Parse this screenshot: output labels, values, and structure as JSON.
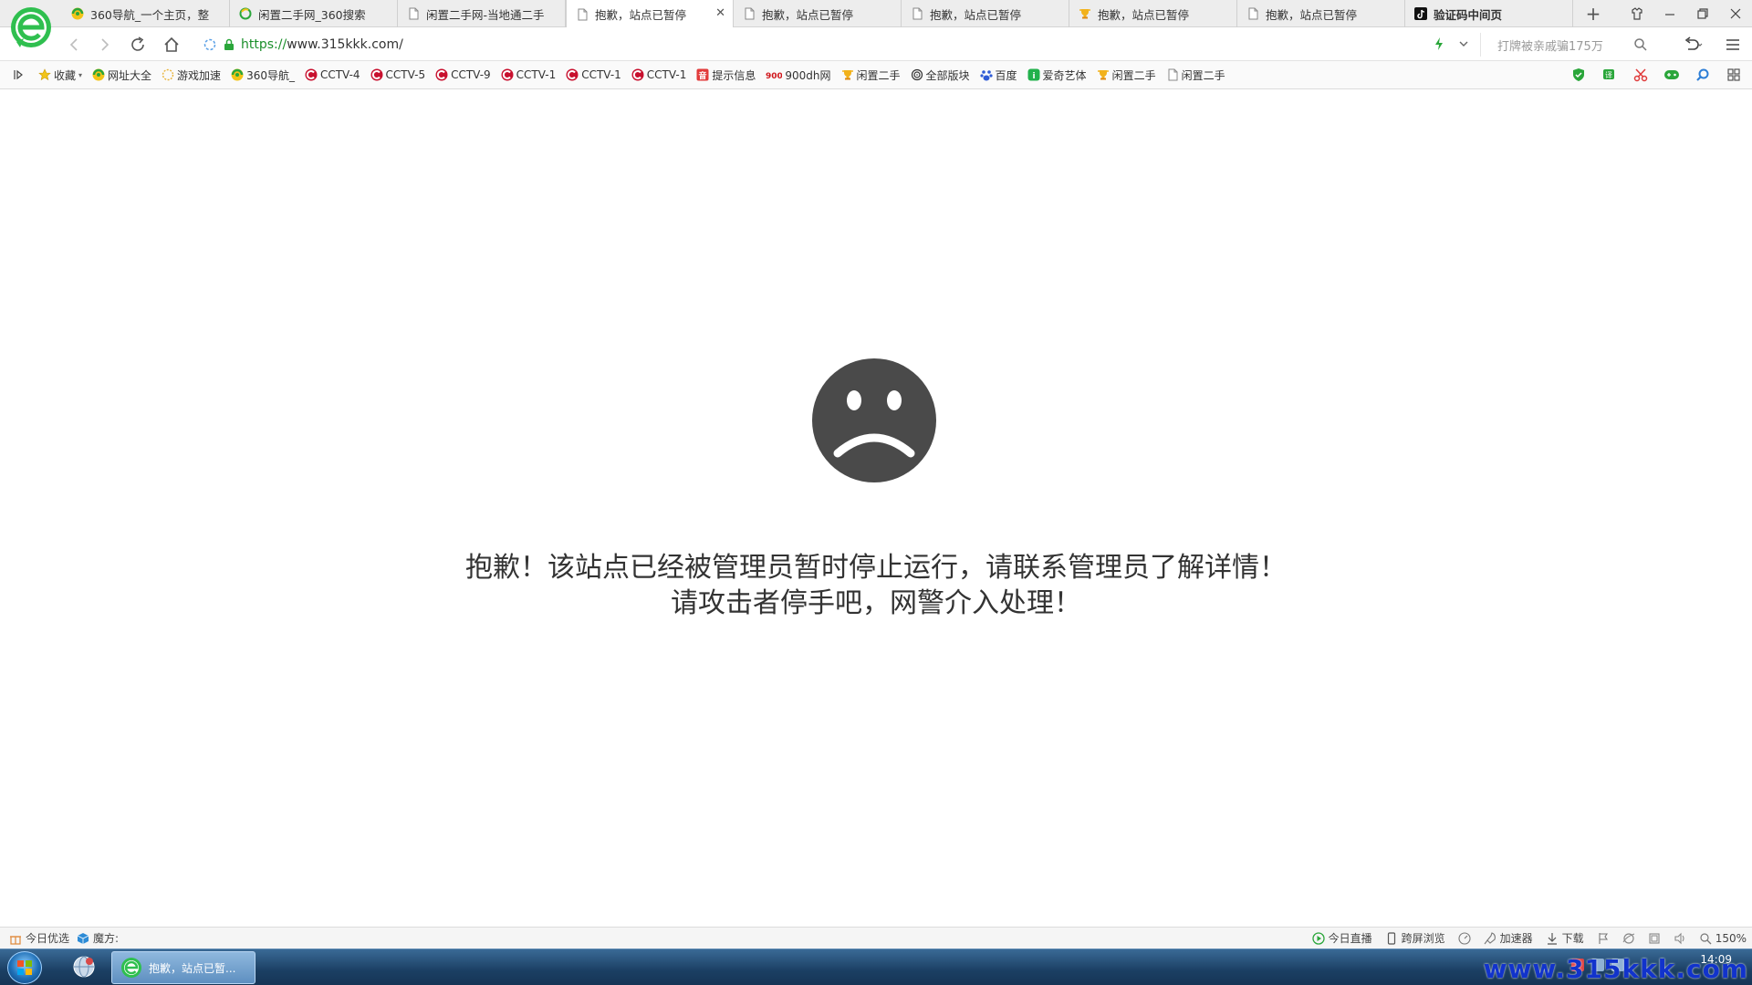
{
  "browser": {
    "tabs": [
      {
        "label": "360导航_一个主页，整",
        "icon": "360-nav-icon",
        "active": false
      },
      {
        "label": "闲置二手网_360搜索",
        "icon": "360-search-icon",
        "active": false
      },
      {
        "label": "闲置二手网-当地通二手",
        "icon": "page-icon",
        "active": false
      },
      {
        "label": "抱歉，站点已暂停",
        "icon": "page-icon",
        "active": true
      },
      {
        "label": "抱歉，站点已暂停",
        "icon": "page-icon",
        "active": false
      },
      {
        "label": "抱歉，站点已暂停",
        "icon": "page-icon",
        "active": false
      },
      {
        "label": "抱歉，站点已暂停",
        "icon": "trophy-icon",
        "active": false
      },
      {
        "label": "抱歉，站点已暂停",
        "icon": "page-icon",
        "active": false
      },
      {
        "label": "验证码中间页",
        "icon": "tiktok-icon",
        "active": false
      }
    ],
    "address": {
      "scheme": "https://",
      "host": "www.315kkk.com/"
    },
    "search_placeholder": "打牌被亲戚骗175万",
    "bookmarks": [
      {
        "label": "收藏",
        "icon": "star-icon"
      },
      {
        "label": "网址大全",
        "icon": "360-nav-icon"
      },
      {
        "label": "游戏加速",
        "icon": "game-icon"
      },
      {
        "label": "360导航_",
        "icon": "360-nav-icon"
      },
      {
        "label": "CCTV-4",
        "icon": "cctv-icon"
      },
      {
        "label": "CCTV-5",
        "icon": "cctv-icon"
      },
      {
        "label": "CCTV-9",
        "icon": "cctv-icon"
      },
      {
        "label": "CCTV-1",
        "icon": "cctv-icon"
      },
      {
        "label": "CCTV-1",
        "icon": "cctv-icon"
      },
      {
        "label": "CCTV-1",
        "icon": "cctv-icon"
      },
      {
        "label": "提示信息",
        "icon": "info-icon"
      },
      {
        "label": "900dh网",
        "icon": "900-icon"
      },
      {
        "label": "闲置二手",
        "icon": "trophy-icon"
      },
      {
        "label": "全部版块",
        "icon": "fingerprint-icon"
      },
      {
        "label": "百度",
        "icon": "baidu-icon"
      },
      {
        "label": "爱奇艺体",
        "icon": "iqiyi-icon"
      },
      {
        "label": "闲置二手",
        "icon": "trophy-icon"
      },
      {
        "label": "闲置二手",
        "icon": "page-icon"
      }
    ]
  },
  "page": {
    "message": "抱歉！该站点已经被管理员暂时停止运行，请联系管理员了解详情！请攻击者停手吧，网警介入处理！"
  },
  "statusbar": {
    "left": [
      {
        "label": "今日优选",
        "icon": "gift-icon"
      },
      {
        "label": "魔方:",
        "icon": "cube-icon"
      }
    ],
    "right": [
      {
        "label": "今日直播",
        "icon": "play-icon"
      },
      {
        "label": "跨屏浏览",
        "icon": "phone-icon"
      },
      {
        "label": "",
        "icon": "speed-icon"
      },
      {
        "label": "加速器",
        "icon": "rocket-icon"
      },
      {
        "label": "下载",
        "icon": "download-icon"
      },
      {
        "label": "",
        "icon": "flag-icon"
      },
      {
        "label": "",
        "icon": "ie-icon"
      },
      {
        "label": "",
        "icon": "window-icon"
      },
      {
        "label": "",
        "icon": "sound-icon"
      },
      {
        "label": "150%",
        "icon": "zoom-icon"
      }
    ]
  },
  "taskbar": {
    "task_label": "抱歉，站点已暂...",
    "clock_time": "14:09",
    "watermark": "www.315kkk.com"
  },
  "colors": {
    "url_green": "#1a8f2a",
    "face_gray": "#4a4a4a",
    "taskbar_blue": "#1b3f63"
  }
}
